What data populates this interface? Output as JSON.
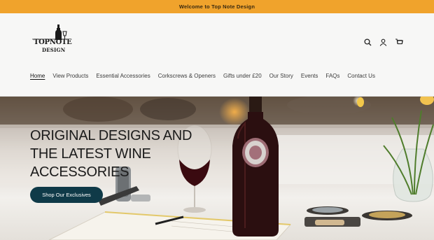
{
  "announcement": {
    "text": "Welcome to Top Note Design"
  },
  "logo": {
    "line1": "TOPNOTE",
    "line2": "DESIGN"
  },
  "header_icons": [
    "search-icon",
    "account-icon",
    "cart-icon"
  ],
  "nav": {
    "items": [
      {
        "label": "Home",
        "active": true
      },
      {
        "label": "View Products"
      },
      {
        "label": "Essential Accessories"
      },
      {
        "label": "Corkscrews & Openers"
      },
      {
        "label": "Gifts under £20"
      },
      {
        "label": "Our Story"
      },
      {
        "label": "Events"
      },
      {
        "label": "FAQs"
      },
      {
        "label": "Contact Us"
      }
    ]
  },
  "hero": {
    "title_lines": [
      "ORIGINAL DESIGNS AND",
      "THE LATEST WINE",
      "ACCESSORIES"
    ],
    "cta_label": "Shop Our Exclusives"
  },
  "colors": {
    "announcement_bg": "#f0a32c",
    "cta_bg": "#0f3a48",
    "header_bg": "#f7f7f6"
  }
}
